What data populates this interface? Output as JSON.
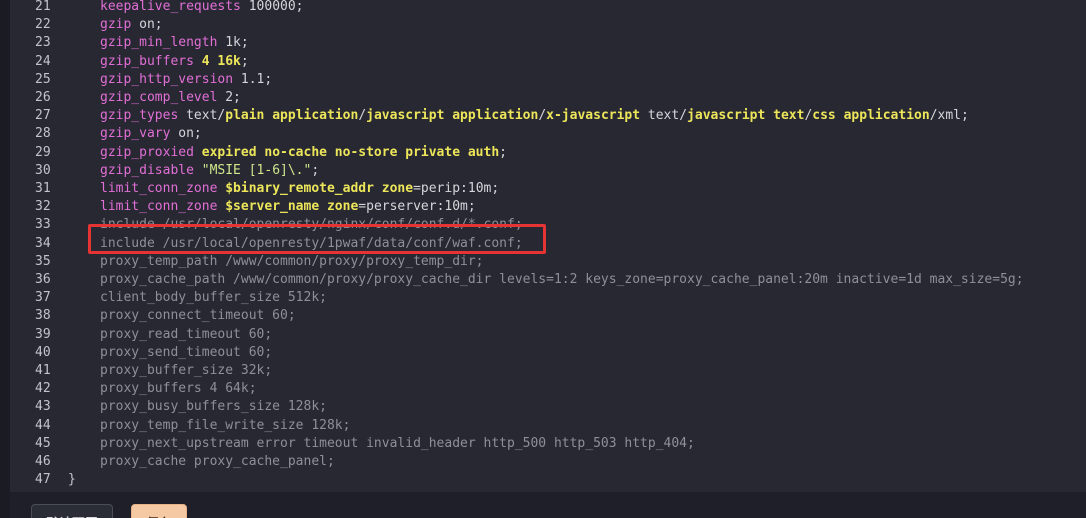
{
  "editor": {
    "lines": [
      {
        "num": "21",
        "parts": [
          {
            "c": "kw",
            "t": "keepalive_requests"
          },
          {
            "c": "op",
            "t": " 100000;"
          }
        ]
      },
      {
        "num": "22",
        "parts": [
          {
            "c": "kw",
            "t": "gzip"
          },
          {
            "c": "op",
            "t": " on;"
          }
        ]
      },
      {
        "num": "23",
        "parts": [
          {
            "c": "kw",
            "t": "gzip_min_length"
          },
          {
            "c": "op",
            "t": " 1k;"
          }
        ]
      },
      {
        "num": "24",
        "parts": [
          {
            "c": "kw",
            "t": "gzip_buffers"
          },
          {
            "c": "y",
            "t": " 4 16k"
          },
          {
            "c": "op",
            "t": ";"
          }
        ]
      },
      {
        "num": "25",
        "parts": [
          {
            "c": "kw",
            "t": "gzip_http_version"
          },
          {
            "c": "op",
            "t": " 1.1;"
          }
        ]
      },
      {
        "num": "26",
        "parts": [
          {
            "c": "kw",
            "t": "gzip_comp_level"
          },
          {
            "c": "op",
            "t": " 2;"
          }
        ]
      },
      {
        "num": "27",
        "parts": [
          {
            "c": "kw",
            "t": "gzip_types"
          },
          {
            "c": "op",
            "t": " text/"
          },
          {
            "c": "y",
            "t": "plain application"
          },
          {
            "c": "op",
            "t": "/"
          },
          {
            "c": "y",
            "t": "javascript application"
          },
          {
            "c": "op",
            "t": "/"
          },
          {
            "c": "y",
            "t": "x-javascript"
          },
          {
            "c": "op",
            "t": " text/"
          },
          {
            "c": "y",
            "t": "javascript text"
          },
          {
            "c": "op",
            "t": "/"
          },
          {
            "c": "y",
            "t": "css application"
          },
          {
            "c": "op",
            "t": "/xml;"
          }
        ]
      },
      {
        "num": "28",
        "parts": [
          {
            "c": "kw",
            "t": "gzip_vary"
          },
          {
            "c": "op",
            "t": " on;"
          }
        ]
      },
      {
        "num": "29",
        "parts": [
          {
            "c": "kw",
            "t": "gzip_proxied"
          },
          {
            "c": "y",
            "t": " expired no-cache no-store private auth"
          },
          {
            "c": "op",
            "t": ";"
          }
        ]
      },
      {
        "num": "30",
        "parts": [
          {
            "c": "kw",
            "t": "gzip_disable"
          },
          {
            "c": "str",
            "t": " \"MSIE [1-6]\\.\""
          },
          {
            "c": "op",
            "t": ";"
          }
        ]
      },
      {
        "num": "31",
        "parts": [
          {
            "c": "kw",
            "t": "limit_conn_zone"
          },
          {
            "c": "y",
            "t": " $binary_remote_addr zone"
          },
          {
            "c": "op",
            "t": "=perip:10m;"
          }
        ]
      },
      {
        "num": "32",
        "parts": [
          {
            "c": "kw",
            "t": "limit_conn_zone"
          },
          {
            "c": "y",
            "t": " $server_name zone"
          },
          {
            "c": "op",
            "t": "=perserver:10m;"
          }
        ]
      },
      {
        "num": "33",
        "parts": [
          {
            "c": "dim",
            "t": "include /usr/local/openresty/nginx/conf/conf.d/*.conf;"
          }
        ]
      },
      {
        "num": "34",
        "parts": [
          {
            "c": "dim",
            "t": "include /usr/local/openresty/1pwaf/data/conf/waf.conf;"
          }
        ]
      },
      {
        "num": "35",
        "parts": [
          {
            "c": "dim",
            "t": "proxy_temp_path /www/common/proxy/proxy_temp_dir;"
          }
        ]
      },
      {
        "num": "36",
        "parts": [
          {
            "c": "dim",
            "t": "proxy_cache_path /www/common/proxy/proxy_cache_dir levels=1:2 keys_zone=proxy_cache_panel:20m inactive=1d max_size=5g;"
          }
        ]
      },
      {
        "num": "37",
        "parts": [
          {
            "c": "dim",
            "t": "client_body_buffer_size 512k;"
          }
        ]
      },
      {
        "num": "38",
        "parts": [
          {
            "c": "dim",
            "t": "proxy_connect_timeout 60;"
          }
        ]
      },
      {
        "num": "39",
        "parts": [
          {
            "c": "dim",
            "t": "proxy_read_timeout 60;"
          }
        ]
      },
      {
        "num": "40",
        "parts": [
          {
            "c": "dim",
            "t": "proxy_send_timeout 60;"
          }
        ]
      },
      {
        "num": "41",
        "parts": [
          {
            "c": "dim",
            "t": "proxy_buffer_size 32k;"
          }
        ]
      },
      {
        "num": "42",
        "parts": [
          {
            "c": "dim",
            "t": "proxy_buffers 4 64k;"
          }
        ]
      },
      {
        "num": "43",
        "parts": [
          {
            "c": "dim",
            "t": "proxy_busy_buffers_size 128k;"
          }
        ]
      },
      {
        "num": "44",
        "parts": [
          {
            "c": "dim",
            "t": "proxy_temp_file_write_size 128k;"
          }
        ]
      },
      {
        "num": "45",
        "parts": [
          {
            "c": "dim",
            "t": "proxy_next_upstream error timeout invalid_header http_500 http_503 http_404;"
          }
        ]
      },
      {
        "num": "46",
        "parts": [
          {
            "c": "dim",
            "t": "proxy_cache proxy_cache_panel;"
          }
        ]
      },
      {
        "num": "47",
        "parts": [
          {
            "c": "bracket",
            "t": "}"
          }
        ]
      }
    ]
  },
  "footer": {
    "default_label": "默认配置",
    "save_label": "保存"
  },
  "colors": {
    "highlight_border": "#e63434",
    "save_button": "#f4c9a4"
  }
}
